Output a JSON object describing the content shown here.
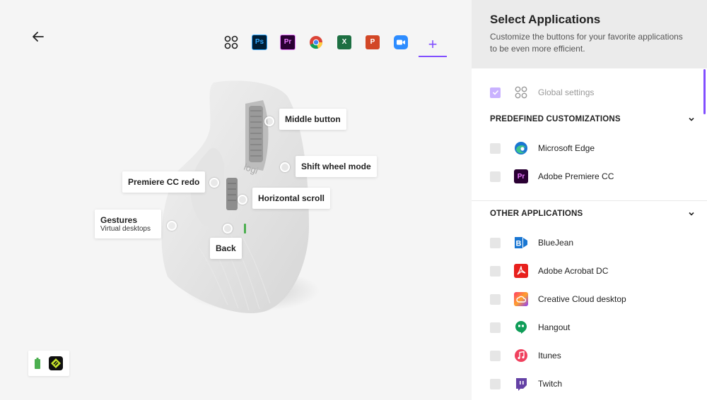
{
  "window": {
    "buttons": [
      "#ff5f57",
      "#febc2e",
      "#28c840"
    ]
  },
  "toolbar": {
    "apps": [
      {
        "name": "global-settings",
        "text": ""
      },
      {
        "name": "photoshop",
        "text": "Ps",
        "bg": "#001e36",
        "fg": "#31a8ff"
      },
      {
        "name": "premiere",
        "text": "Pr",
        "bg": "#2a0033",
        "fg": "#ea77ff"
      },
      {
        "name": "chrome",
        "text": ""
      },
      {
        "name": "excel",
        "text": "X",
        "bg": "#1d6f42",
        "fg": "#ffffff"
      },
      {
        "name": "powerpoint",
        "text": "P",
        "bg": "#d24726",
        "fg": "#ffffff"
      },
      {
        "name": "zoom",
        "text": "",
        "bg": "#2d8cff"
      }
    ],
    "add_label": "+"
  },
  "mouse": {
    "logo": "logi",
    "callouts": {
      "middle": "Middle button",
      "shift": "Shift wheel mode",
      "redo": "Premiere CC redo",
      "horizontal": "Horizontal scroll",
      "gestures_title": "Gestures",
      "gestures_sub": "Virtual desktops",
      "back": "Back"
    }
  },
  "panel": {
    "title": "Select Applications",
    "description": "Customize the buttons for your favorite applications to be even more efficient.",
    "global_label": "Global settings",
    "predefined_header": "PREDEFINED CUSTOMIZATIONS",
    "predefined": [
      "Microsoft Edge",
      "Adobe Premiere CC"
    ],
    "other_header": "OTHER APPLICATIONS",
    "other": [
      "BlueJean",
      "Adobe Acrobat DC",
      "Creative Cloud desktop",
      "Hangout",
      "Itunes",
      "Twitch"
    ]
  },
  "colors": {
    "accent": "#814eff",
    "panel_header_bg": "#ebebeb"
  }
}
